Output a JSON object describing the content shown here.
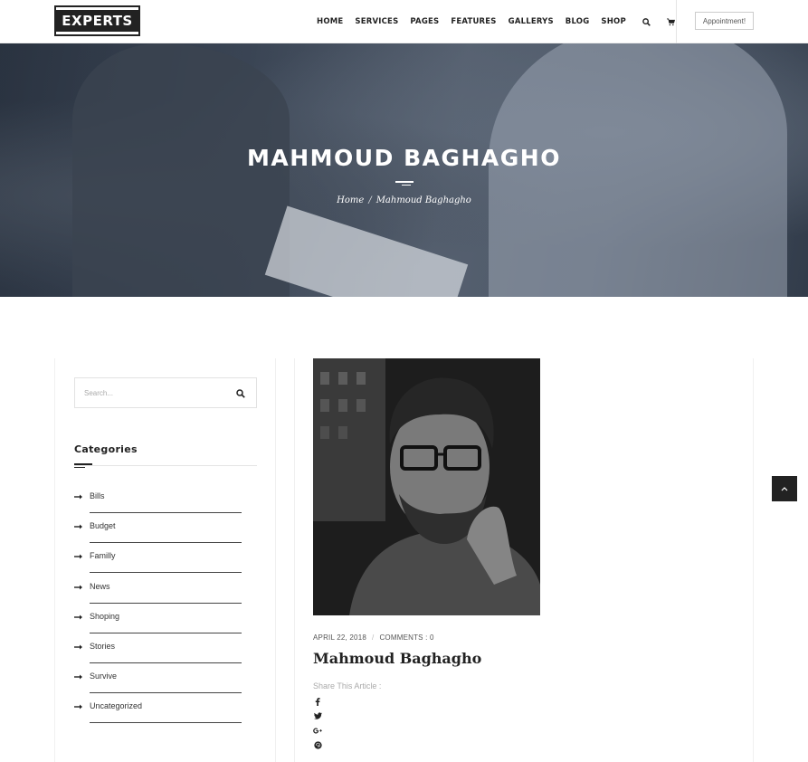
{
  "header": {
    "logo_text": "EXPERTS",
    "nav": [
      "HOME",
      "SERVICES",
      "PAGES",
      "FEATURES",
      "GALLERYS",
      "BLOG",
      "SHOP"
    ],
    "appointment_label": "Appointment!"
  },
  "hero": {
    "title": "MAHMOUD BAGHAGHO",
    "breadcrumb_home": "Home",
    "breadcrumb_sep": "/",
    "breadcrumb_current": "Mahmoud Baghagho"
  },
  "sidebar": {
    "search_placeholder": "Search...",
    "categories_title": "Categories",
    "categories": [
      "Bills",
      "Budget",
      "Familly",
      "News",
      "Shoping",
      "Stories",
      "Survive",
      "Uncategorized"
    ]
  },
  "article": {
    "date": "APRIL 22, 2018",
    "meta_sep": "/",
    "comments": "COMMENTS : 0",
    "title": "Mahmoud Baghagho",
    "share_label": "Share This Article :",
    "share_icons": [
      "facebook-icon",
      "twitter-icon",
      "google-plus-icon",
      "pinterest-icon"
    ]
  },
  "colors": {
    "dark": "#222222",
    "hero_overlay": "#1e2a38"
  }
}
